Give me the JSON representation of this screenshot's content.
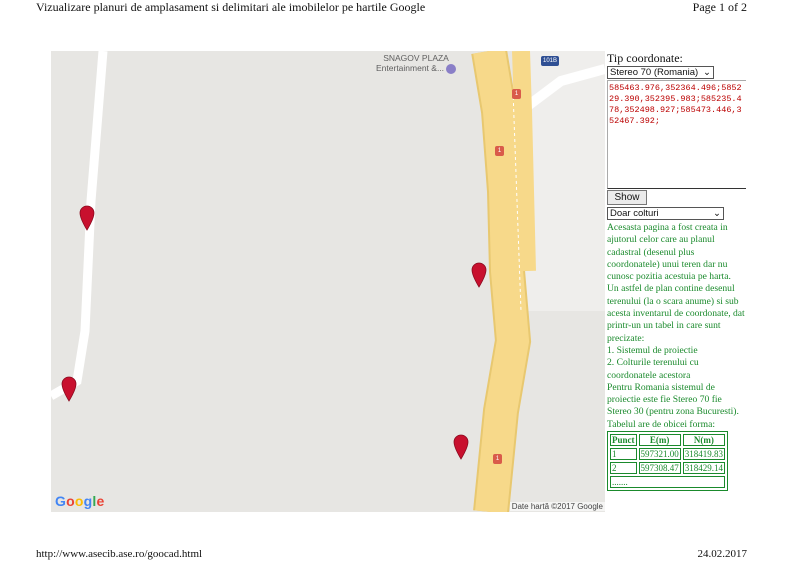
{
  "header": {
    "title": "Vizualizare planuri de amplasament si delimitari ale imobilelor pe hartile Google",
    "page": "Page 1 of 2"
  },
  "footer": {
    "url": "http://www.asecib.ase.ro/goocad.html",
    "date": "24.02.2017"
  },
  "map": {
    "poi_name": "SNAGOV PLAZA",
    "poi_sub": "Entertainment &...",
    "route_shield": "1",
    "route_shield_blue": "101B",
    "logo": "Google",
    "credit": "Date hartă ©2017 Google"
  },
  "panel": {
    "coord_label": "Tip coordonate:",
    "coord_system_selected": "Stereo 70 (Romania)",
    "coords_text": "585463.976,352364.496;585229.390,352395.983;585235.478,352498.927;585473.446,352467.392;",
    "show_button": "Show",
    "mode_selected": "Doar colturi",
    "description": [
      "Acesasta pagina a fost creata in ajutorul celor care au planul cadastral (desenul plus coordonatele) unui teren dar nu cunosc pozitia acestuia pe harta.",
      "Un astfel de plan contine desenul terenului (la o scara anume) si sub acesta inventarul de coordonate, dat printr-un un tabel in care sunt precizate:",
      "1. Sistemul de proiectie",
      "2. Colturile terenului cu coordonatele acestora",
      "Pentru Romania sistemul de proiectie este fie Stereo 70 fie Stereo 30 (pentru zona Bucuresti).",
      "Tabelul are de obicei forma:"
    ],
    "table": {
      "headers": [
        "Punct",
        "E(m)",
        "N(m)"
      ],
      "rows": [
        [
          "1",
          "597321.00",
          "318419.83"
        ],
        [
          "2",
          "597308.47",
          "318429.14"
        ]
      ],
      "ellipsis": "......."
    }
  },
  "colors": {
    "pin": "#c8102e",
    "text_green": "#1a8a2c",
    "road_yellow": "#f7d98a",
    "map_bg": "#e7e6e3"
  }
}
